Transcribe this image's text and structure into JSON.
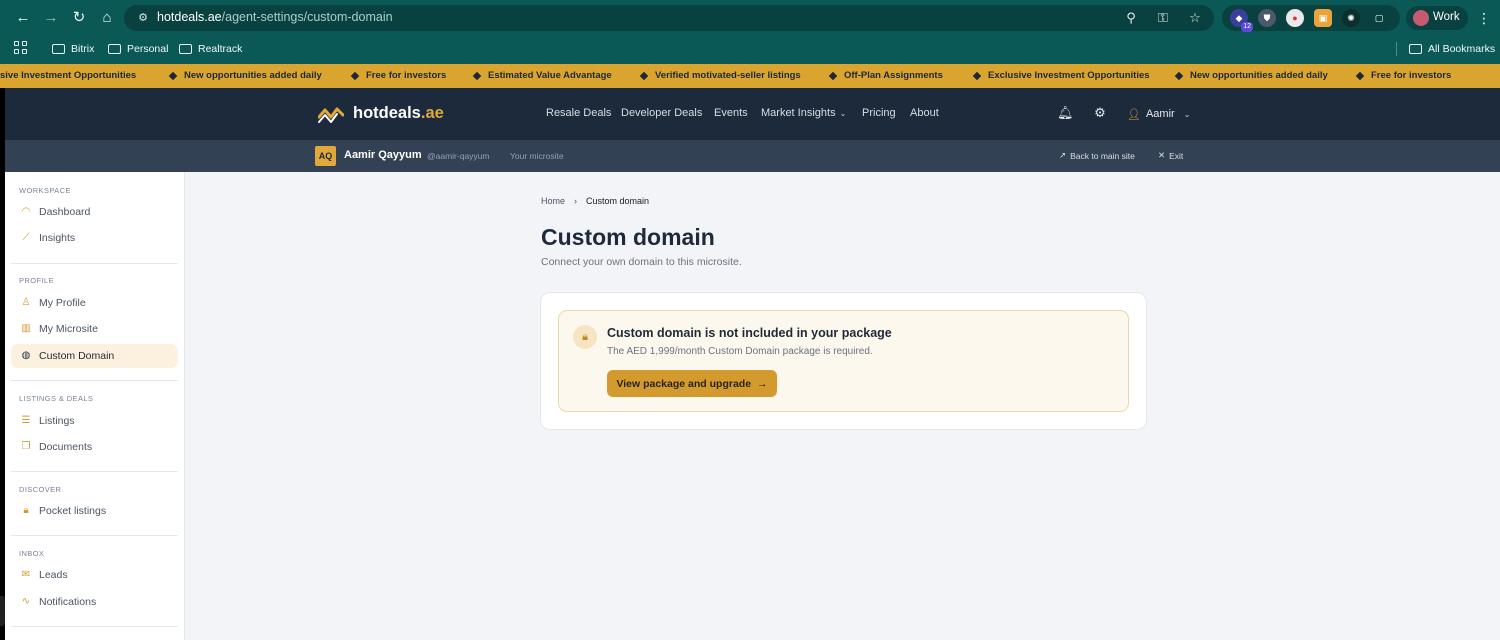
{
  "browser": {
    "url_host": "hotdeals.ae",
    "url_path": "/agent-settings/custom-domain",
    "extension_badge": "12",
    "profile_name": "Work",
    "bookmarks": [
      "Bitrix",
      "Personal",
      "Realtrack"
    ],
    "all_bookmarks": "All Bookmarks"
  },
  "ticker": {
    "items": [
      "sive Investment Opportunities",
      "New opportunities added daily",
      "Free for investors",
      "Estimated Value Advantage",
      "Verified motivated-seller listings",
      "Off-Plan Assignments",
      "Exclusive Investment Opportunities",
      "New opportunities added daily",
      "Free for investors"
    ]
  },
  "header": {
    "logo_name": "hotdeals",
    "logo_tld": ".ae",
    "nav": [
      "Resale Deals",
      "Developer Deals",
      "Events",
      "Market Insights",
      "Pricing",
      "About"
    ],
    "user_name": "Aamir"
  },
  "subbar": {
    "initials": "AQ",
    "name": "Aamir Qayyum",
    "handle": "@aamir-qayyum",
    "microsite_label": "Your microsite",
    "back_link": "Back to main site",
    "exit_link": "Exit"
  },
  "sidebar": {
    "sections": [
      {
        "title": "WORKSPACE",
        "items": [
          "Dashboard",
          "Insights"
        ]
      },
      {
        "title": "PROFILE",
        "items": [
          "My Profile",
          "My Microsite",
          "Custom Domain"
        ]
      },
      {
        "title": "LISTINGS & DEALS",
        "items": [
          "Listings",
          "Documents"
        ]
      },
      {
        "title": "DISCOVER",
        "items": [
          "Pocket listings"
        ]
      },
      {
        "title": "INBOX",
        "items": [
          "Leads",
          "Notifications"
        ]
      }
    ],
    "active_item": "Custom Domain"
  },
  "main": {
    "breadcrumb": {
      "home": "Home",
      "separator": "›",
      "current": "Custom domain"
    },
    "title": "Custom domain",
    "subtitle": "Connect your own domain to this microsite.",
    "notice": {
      "title": "Custom domain is not included in your package",
      "text": "The AED 1,999/month Custom Domain package is required.",
      "button_label": "View package and upgrade",
      "button_arrow": "→"
    }
  },
  "colors": {
    "browser_chrome": "#0b5957",
    "ticker_bg": "#d9a52f",
    "header_bg": "#1d2a3c",
    "subbar_bg": "#334155",
    "accent": "#d39a2e",
    "notice_bg": "#fdf8ee",
    "active_nav_bg": "#fbf1de"
  }
}
